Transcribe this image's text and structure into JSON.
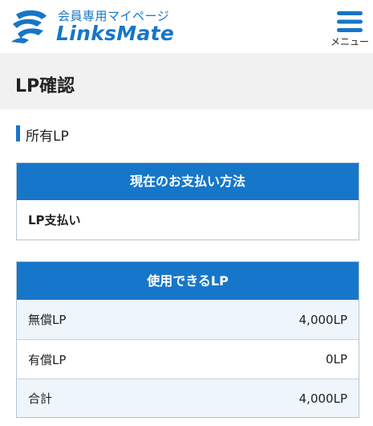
{
  "header": {
    "subtitle": "会員専用マイページ",
    "brand": "LinksMate",
    "menu_label": "メニュー"
  },
  "page": {
    "title": "LP確認"
  },
  "section": {
    "heading": "所有LP"
  },
  "payment": {
    "header": "現在のお支払い方法",
    "value": "LP支払い"
  },
  "usable_lp": {
    "header": "使用できるLP",
    "rows": [
      {
        "label": "無償LP",
        "value": "4,000LP"
      },
      {
        "label": "有償LP",
        "value": "0LP"
      },
      {
        "label": "合計",
        "value": "4,000LP"
      }
    ]
  },
  "colors": {
    "brand_blue": "#1676c9",
    "band_gray": "#f1f1f1",
    "row_blue": "#eef5fb"
  }
}
